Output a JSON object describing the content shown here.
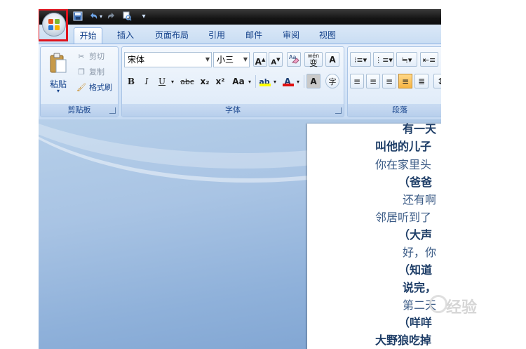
{
  "quick_access": {
    "save_icon": "save-icon",
    "undo_icon": "undo-icon",
    "redo_icon": "redo-icon",
    "print_icon": "print-preview-icon"
  },
  "tabs": [
    {
      "label": "开始",
      "active": true
    },
    {
      "label": "插入"
    },
    {
      "label": "页面布局"
    },
    {
      "label": "引用"
    },
    {
      "label": "邮件"
    },
    {
      "label": "审阅"
    },
    {
      "label": "视图"
    }
  ],
  "clipboard": {
    "paste_label": "粘贴",
    "cut_label": "剪切",
    "copy_label": "复制",
    "format_painter_label": "格式刷",
    "group_label": "剪贴板"
  },
  "font": {
    "font_name": "宋体",
    "font_size": "小三",
    "grow_glyph": "A",
    "shrink_glyph": "A",
    "bold_glyph": "B",
    "italic_glyph": "I",
    "underline_glyph": "U",
    "strike_glyph": "abc",
    "subscript_glyph": "x₂",
    "superscript_glyph": "x²",
    "case_glyph": "Aa",
    "highlight_glyph": "ab",
    "font_color_glyph": "A",
    "shade_glyph": "A",
    "wen_glyph": "wén",
    "bian_glyph": "变",
    "enclose_glyph": "字",
    "group_label": "字体",
    "highlight_color": "#ffff00",
    "font_color": "#e01010"
  },
  "paragraph": {
    "group_label": "段落"
  },
  "document": {
    "lines": [
      "有一天",
      "叫他的儿子",
      "你在家里头",
      "（爸爸",
      "还有啊",
      "邻居听到了",
      "（大声",
      "好，你",
      "（知道",
      "说完，",
      "第二天",
      "（咩咩",
      "大野狼吃掉"
    ]
  },
  "watermark_text": "经验",
  "accent_color": "#15428b"
}
